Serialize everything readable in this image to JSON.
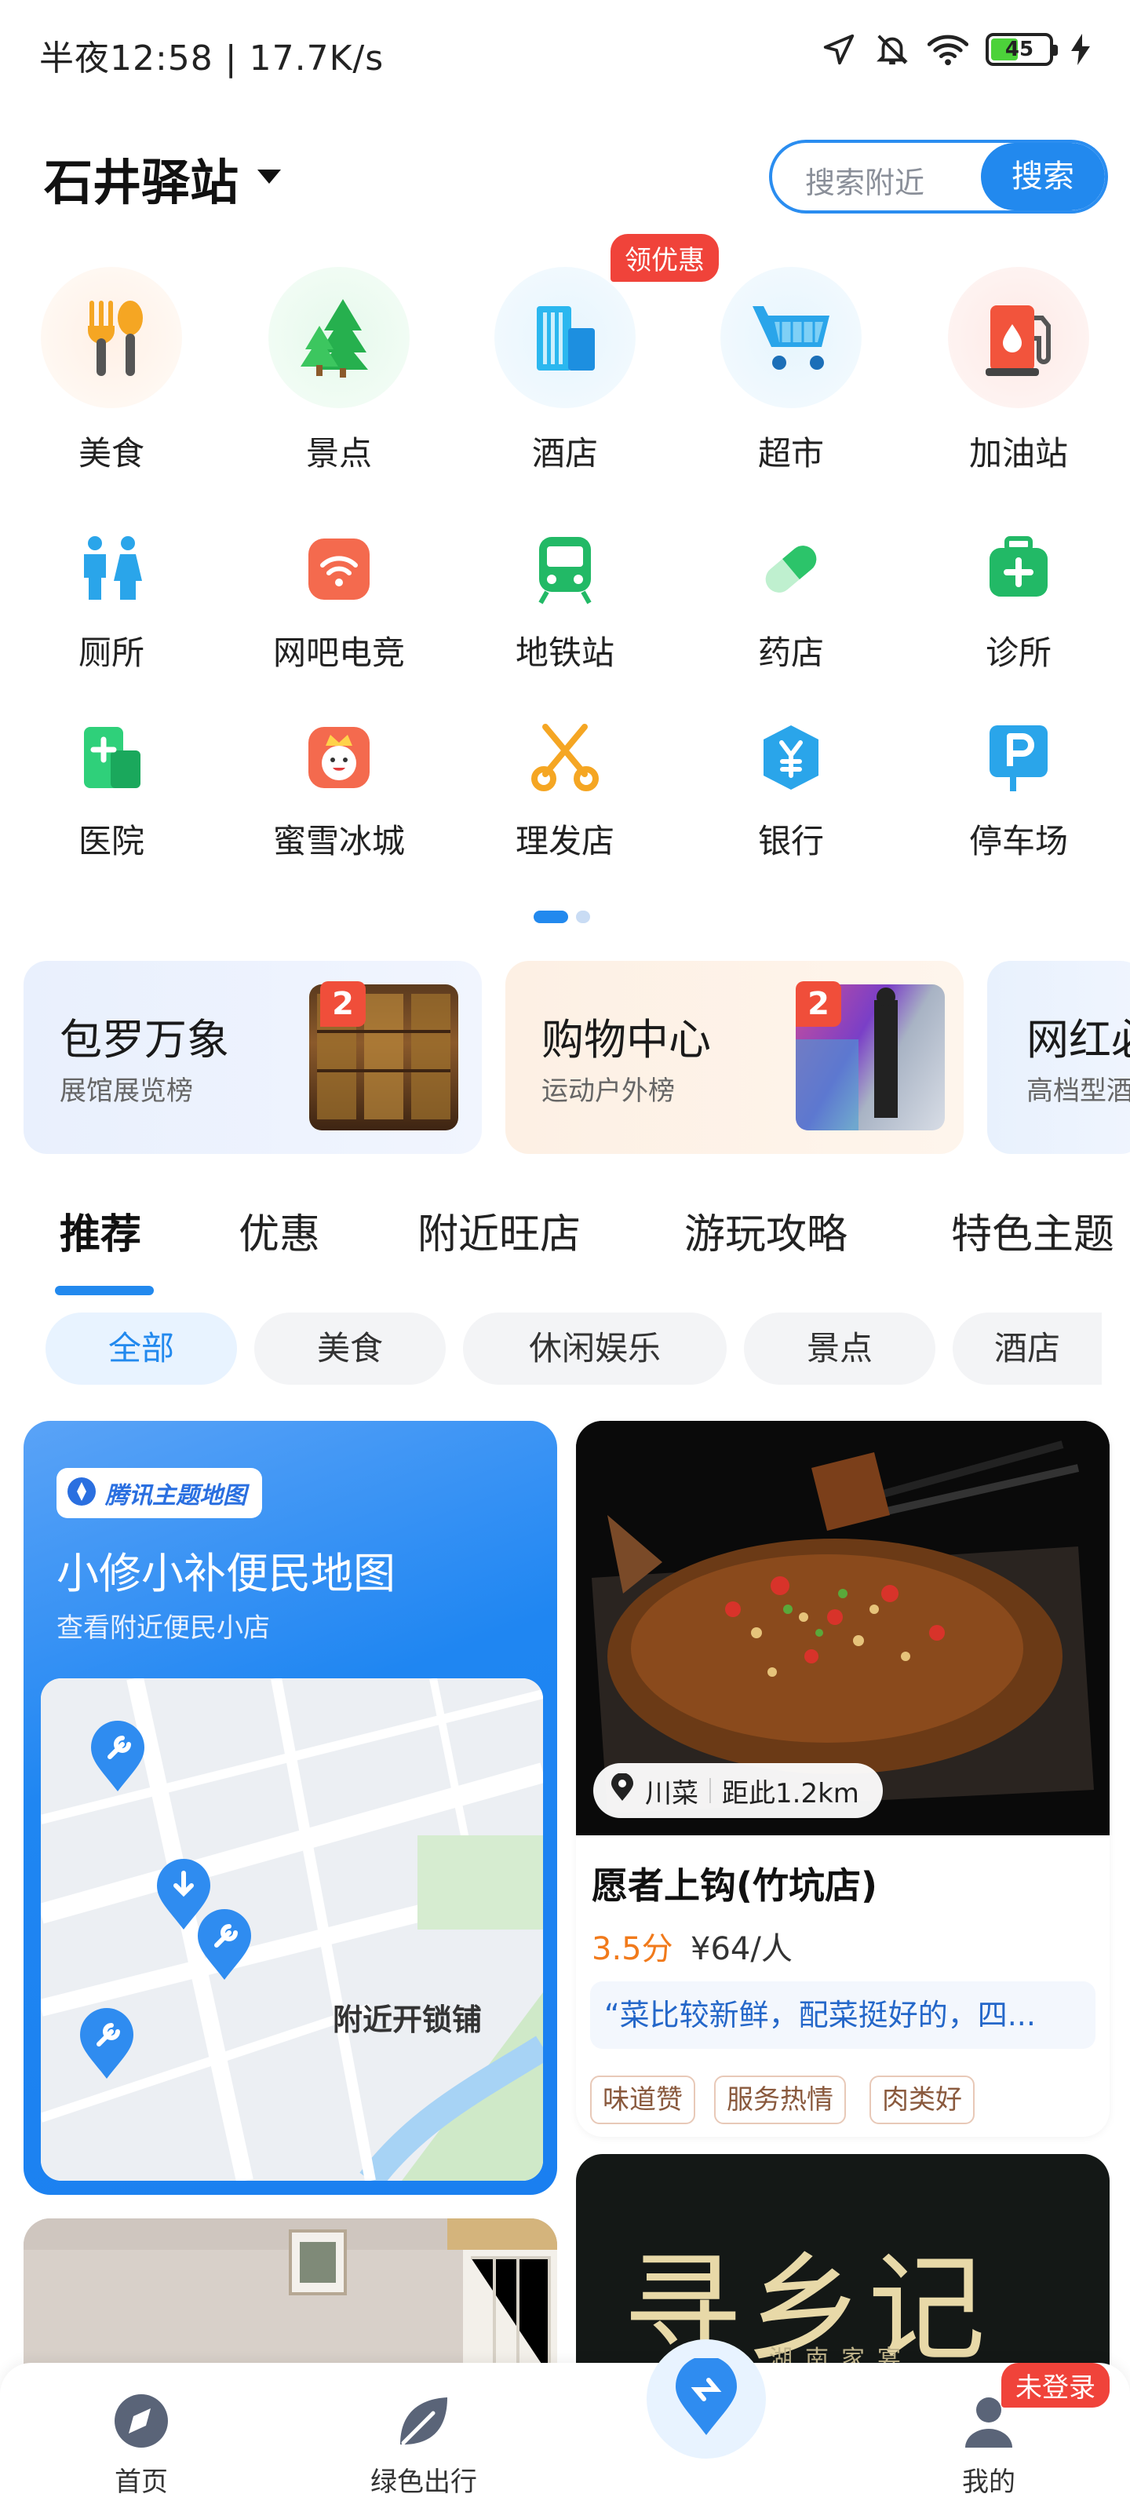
{
  "status_bar": {
    "time": "半夜12:58 | 17.7K/s",
    "battery": "45"
  },
  "header": {
    "location": "石井驿站",
    "search_placeholder": "搜索附近",
    "search_button": "搜索"
  },
  "categories": [
    {
      "label": "美食",
      "icon": "food-icon"
    },
    {
      "label": "景点",
      "icon": "scenic-icon"
    },
    {
      "label": "酒店",
      "icon": "hotel-icon",
      "badge": "领优惠"
    },
    {
      "label": "超市",
      "icon": "supermarket-icon"
    },
    {
      "label": "加油站",
      "icon": "gas-station-icon"
    },
    {
      "label": "厕所",
      "icon": "toilet-icon"
    },
    {
      "label": "网吧电竞",
      "icon": "internet-cafe-icon"
    },
    {
      "label": "地铁站",
      "icon": "subway-icon"
    },
    {
      "label": "药店",
      "icon": "pharmacy-icon"
    },
    {
      "label": "诊所",
      "icon": "clinic-icon"
    },
    {
      "label": "医院",
      "icon": "hospital-icon"
    },
    {
      "label": "蜜雪冰城",
      "icon": "mixue-icon"
    },
    {
      "label": "理发店",
      "icon": "barber-icon"
    },
    {
      "label": "银行",
      "icon": "bank-icon"
    },
    {
      "label": "停车场",
      "icon": "parking-icon"
    }
  ],
  "feature_cards": [
    {
      "title": "包罗万象",
      "subtitle": "展馆展览榜",
      "rank": "2"
    },
    {
      "title": "购物中心",
      "subtitle": "运动户外榜",
      "rank": "2"
    },
    {
      "title": "网红必",
      "subtitle": "高档型酒"
    }
  ],
  "tabs": [
    "推荐",
    "优惠",
    "附近旺店",
    "游玩攻略",
    "特色主题"
  ],
  "chips": [
    "全部",
    "美食",
    "休闲娱乐",
    "景点",
    "酒店"
  ],
  "map_card": {
    "brand": "腾讯主题地图",
    "title": "小修小补便民地图",
    "subtitle": "查看附近便民小店",
    "map_label": "附近开锁铺"
  },
  "food_card": {
    "cuisine": "川菜",
    "distance": "距此1.2km",
    "name": "愿者上钩(竹坑店)",
    "score": "3.5分",
    "price": "¥64/人",
    "quote": "“菜比较新鲜，配菜挺好的，四...",
    "tags": [
      "味道赞",
      "服务热情",
      "肉类好"
    ]
  },
  "dark_card": {
    "title": "寻乡记",
    "subtitle": "湖南家宴"
  },
  "bottom_nav": {
    "home": "首页",
    "green": "绿色出行",
    "mine": "我的",
    "login_badge": "未登录"
  },
  "colors": {
    "accent": "#2289ee",
    "badge_red": "#f0433a",
    "score_orange": "#f17a1b"
  }
}
